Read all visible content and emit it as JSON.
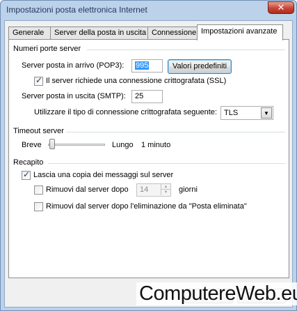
{
  "window": {
    "title": "Impostazioni posta elettronica Internet",
    "close_symbol": "✕"
  },
  "tabs": [
    {
      "label": "Generale",
      "active": false
    },
    {
      "label": "Server della posta in uscita",
      "active": false
    },
    {
      "label": "Connessione",
      "active": false
    },
    {
      "label": "Impostazioni avanzate",
      "active": true
    }
  ],
  "ports": {
    "group_title": "Numeri porte server",
    "incoming_label": "Server posta in arrivo (POP3):",
    "incoming_value": "995",
    "defaults_button": "Valori predefiniti",
    "ssl_checkbox_label": "Il server richiede una connessione crittografata (SSL)",
    "ssl_checked": true,
    "outgoing_label": "Server posta in uscita (SMTP):",
    "outgoing_value": "25",
    "encryption_label": "Utilizzare il tipo di connessione crittografata seguente:",
    "encryption_value": "TLS"
  },
  "timeout": {
    "group_title": "Timeout server",
    "short_label": "Breve",
    "long_label": "Lungo",
    "value_text": "1 minuto"
  },
  "delivery": {
    "group_title": "Recapito",
    "leave_copy_label": "Lascia una copia dei messaggi sul server",
    "leave_copy_checked": true,
    "remove_after_label": "Rimuovi dal server dopo",
    "remove_after_checked": false,
    "remove_after_days": "14",
    "days_unit": "giorni",
    "remove_deleted_label": "Rimuovi dal server dopo l'eliminazione da \"Posta eliminata\"",
    "remove_deleted_checked": false
  },
  "watermark": {
    "text": "ComputereWeb.eu"
  }
}
